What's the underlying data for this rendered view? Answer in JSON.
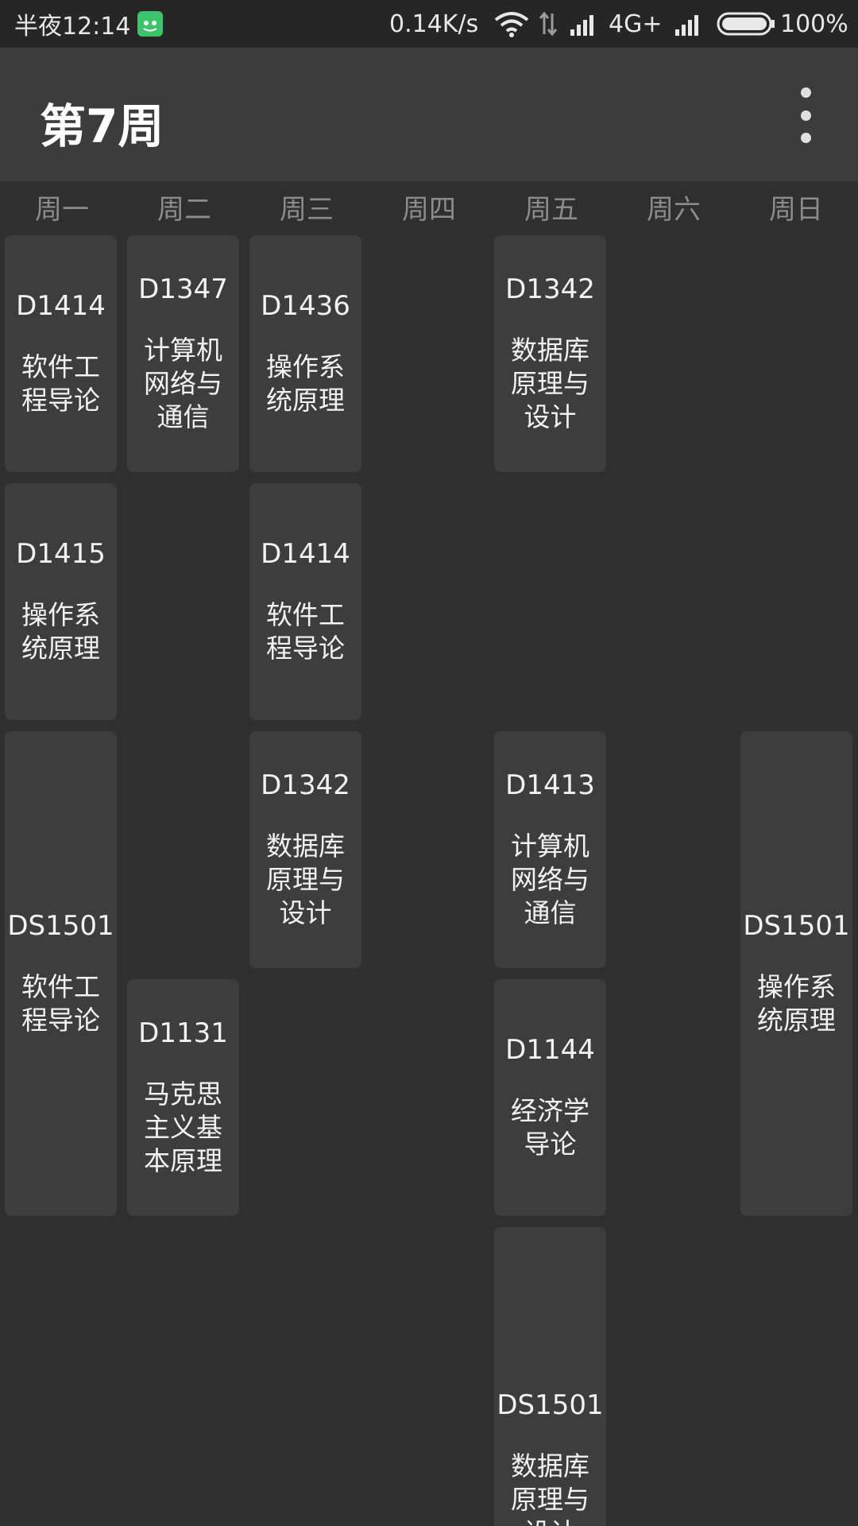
{
  "status": {
    "time": "半夜12:14",
    "speed": "0.14K/s",
    "network": "4G+",
    "battery": "100%"
  },
  "header": {
    "title": "第7周"
  },
  "days": [
    "周一",
    "周二",
    "周三",
    "周四",
    "周五",
    "周六",
    "周日"
  ],
  "courses": [
    {
      "room": "D1414",
      "name": "软件工程导论"
    },
    {
      "room": "D1347",
      "name": "计算机网络与通信"
    },
    {
      "room": "D1436",
      "name": "操作系统原理"
    },
    {
      "room": "D1342",
      "name": "数据库原理与设计"
    },
    {
      "room": "D1415",
      "name": "操作系统原理"
    },
    {
      "room": "D1414",
      "name": "软件工程导论"
    },
    {
      "room": "DS1501",
      "name": "软件工程导论"
    },
    {
      "room": "D1342",
      "name": "数据库原理与设计"
    },
    {
      "room": "D1413",
      "name": "计算机网络与通信"
    },
    {
      "room": "DS1501",
      "name": "操作系统原理"
    },
    {
      "room": "D1131",
      "name": "马克思主义基本原理"
    },
    {
      "room": "D1144",
      "name": "经济学导论"
    },
    {
      "room": "DS1501",
      "name": "数据库原理与设计"
    }
  ]
}
